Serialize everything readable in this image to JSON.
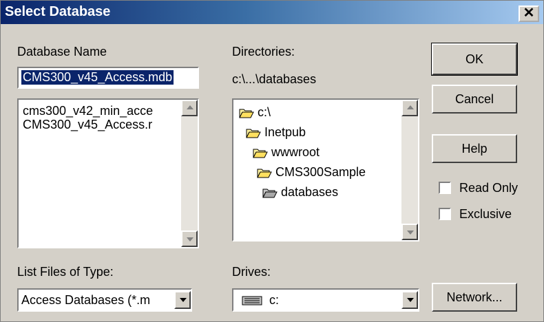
{
  "window": {
    "title": "Select Database",
    "close_glyph": "✕"
  },
  "database_name": {
    "label": "Database Name",
    "value": "CMS300_v45_Access.mdb",
    "files": [
      "cms300_v42_min_acce",
      "CMS300_v45_Access.r"
    ]
  },
  "directories": {
    "label": "Directories:",
    "current_path": "c:\\...\\databases",
    "tree": [
      "c:\\",
      "Inetpub",
      "wwwroot",
      "CMS300Sample",
      "databases"
    ]
  },
  "file_type": {
    "label": "List Files of Type:",
    "value": "Access Databases (*.m"
  },
  "drives": {
    "label": "Drives:",
    "value": "c:"
  },
  "buttons": {
    "ok": "OK",
    "cancel": "Cancel",
    "help": "Help",
    "network": "Network..."
  },
  "options": {
    "read_only": "Read Only",
    "exclusive": "Exclusive"
  },
  "colors": {
    "title_start": "#0a246a",
    "title_end": "#a6caf0",
    "selection": "#0a246a",
    "face": "#d4d0c8"
  }
}
